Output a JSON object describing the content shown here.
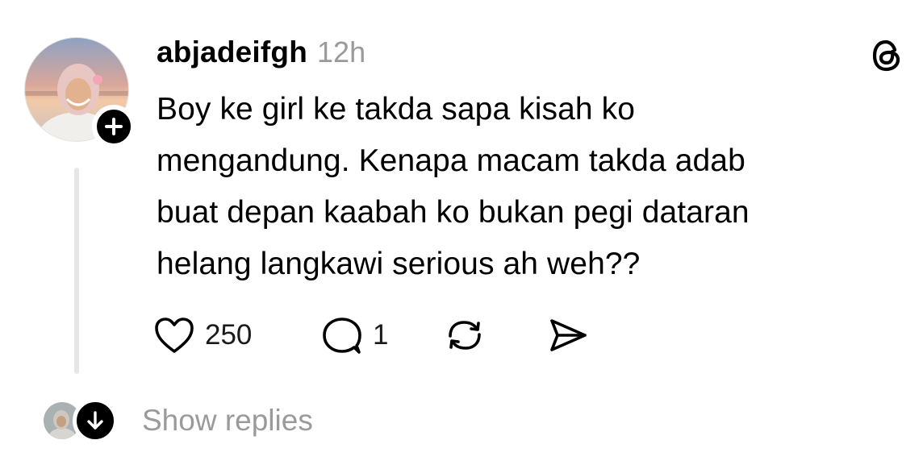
{
  "post": {
    "username": "abjadeifgh",
    "timestamp": "12h",
    "text_lines": [
      "Boy ke girl ke takda sapa kisah ko",
      "mengandung. Kenapa macam takda adab",
      "buat depan kaabah ko bukan pegi dataran",
      "helang langkawi serious ah weh??"
    ],
    "likes": "250",
    "replies": "1"
  },
  "replies_row": {
    "label": "Show replies"
  },
  "icons": {
    "follow": "plus-icon",
    "brand": "threads-logo-icon",
    "like": "heart-icon",
    "reply": "speech-bubble-icon",
    "repost": "repost-icon",
    "share": "send-icon",
    "expand": "arrow-down-icon"
  },
  "colors": {
    "text": "#000000",
    "muted": "#9a9a9a",
    "thread_line": "#e6e6e6"
  }
}
